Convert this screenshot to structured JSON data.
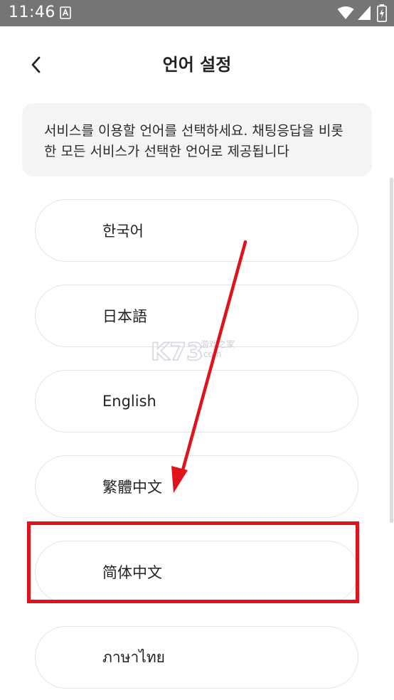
{
  "status_bar": {
    "time": "11:46"
  },
  "header": {
    "title": "언어 설정",
    "back_icon": "chevron-left-icon"
  },
  "info": {
    "text": "서비스를 이용할 언어를 선택하세요. 채팅응답을 비롯한 모든 서비스가 선택한 언어로 제공됩니다"
  },
  "languages": [
    {
      "label": "한국어"
    },
    {
      "label": "日本語"
    },
    {
      "label": "English"
    },
    {
      "label": "繁體中文"
    },
    {
      "label": "简体中文"
    },
    {
      "label": "ภาษาไทย"
    }
  ],
  "watermark": {
    "text": "K73",
    "sub_top": "游戏之家",
    "sub_bottom": ".com"
  },
  "colors": {
    "status_bar": "#757575",
    "annotation_red": "#e0131d",
    "info_bg": "#f4f4f4",
    "item_border": "#e4e4e4"
  }
}
